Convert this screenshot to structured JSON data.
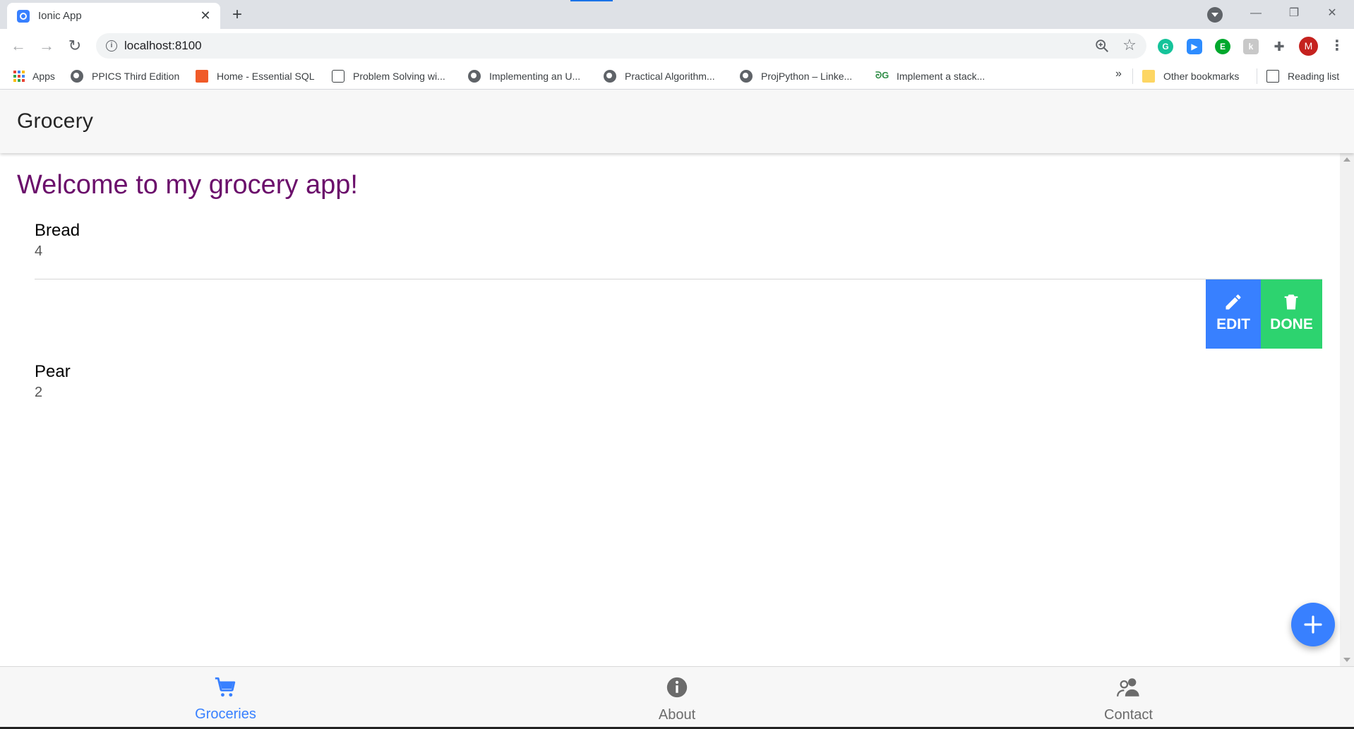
{
  "browser": {
    "tab_title": "Ionic App",
    "tab_close": "✕",
    "new_tab": "+",
    "url": "localhost:8100",
    "avatar_letter": "M",
    "window_controls": {
      "minimize": "—",
      "restore": "❐",
      "close": "✕"
    },
    "bookmarks": [
      {
        "label": "Apps",
        "icon": "apps-grid-icon"
      },
      {
        "label": "PPICS Third Edition",
        "icon": "globe-icon"
      },
      {
        "label": "Home - Essential SQL",
        "icon": "sql-icon"
      },
      {
        "label": "Problem Solving wi...",
        "icon": "document-icon"
      },
      {
        "label": "Implementing an U...",
        "icon": "globe-icon"
      },
      {
        "label": "Practical Algorithm...",
        "icon": "globe-icon"
      },
      {
        "label": "ProjPython – Linke...",
        "icon": "globe-icon"
      },
      {
        "label": "Implement a stack...",
        "icon": "gfg-icon"
      }
    ],
    "overflow": "»",
    "other_bookmarks": "Other bookmarks",
    "reading_list": "Reading list"
  },
  "app": {
    "header_title": "Grocery",
    "welcome": "Welcome to my grocery app!",
    "items": [
      {
        "name": "Bread",
        "quantity": "4"
      },
      {
        "name": "Pear",
        "quantity": "2"
      }
    ],
    "sliding_options": {
      "edit": "EDIT",
      "done": "DONE"
    },
    "tabs": [
      {
        "label": "Groceries",
        "icon": "cart-icon",
        "selected": true
      },
      {
        "label": "About",
        "icon": "information-circle-icon",
        "selected": false
      },
      {
        "label": "Contact",
        "icon": "people-icon",
        "selected": false
      }
    ]
  },
  "colors": {
    "primary": "#3880ff",
    "success": "#2dd36f",
    "welcome_text": "#6b0f6b",
    "tab_inactive": "#6b6b6b"
  }
}
